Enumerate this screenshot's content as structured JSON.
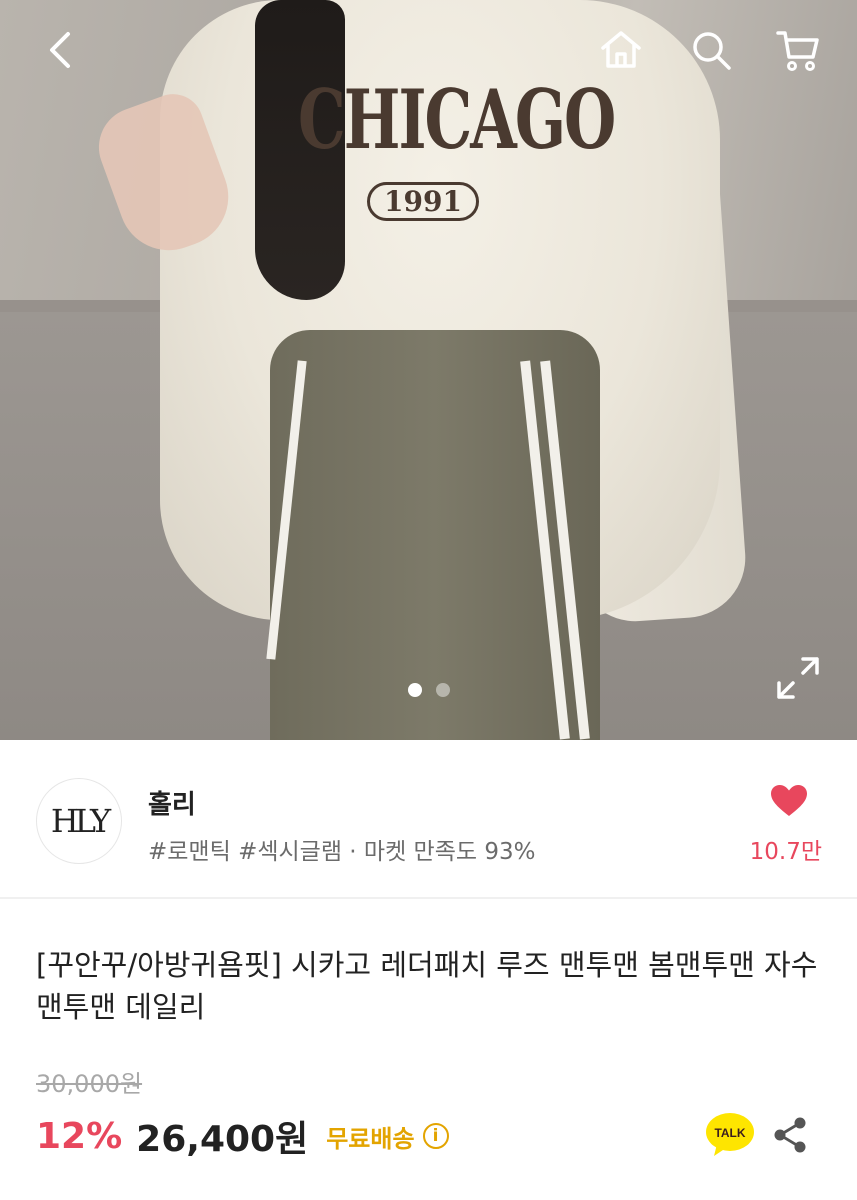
{
  "hero": {
    "print_main": "CHICAGO",
    "print_year": "1991",
    "current_slide": 1,
    "total_slides": 2
  },
  "icons": {
    "back": "chevron-left-icon",
    "home": "home-icon",
    "search": "search-icon",
    "cart": "cart-icon",
    "expand": "expand-icon",
    "like": "heart-icon",
    "kakao": "kakao-talk-icon",
    "share": "share-icon",
    "info": "info-icon"
  },
  "shop": {
    "logo_text": "HLY",
    "name": "홀리",
    "tags": "#로맨틱 #섹시글램 · 마켓 만족도 93%",
    "likes": "10.7만"
  },
  "product": {
    "title": "[꾸안꾸/아방귀욤핏] 시카고 레더패치 루즈 맨투맨 봄맨투맨 자수맨투맨 데일리",
    "original_price": "30,000원",
    "discount": "12%",
    "price": "26,400원",
    "shipping": "무료배송",
    "info_glyph": "i"
  },
  "kakao": {
    "label": "TALK"
  },
  "colors": {
    "accent": "#e8475d",
    "shipping": "#e3a400",
    "text": "#222222",
    "muted": "#6b6b6b"
  }
}
